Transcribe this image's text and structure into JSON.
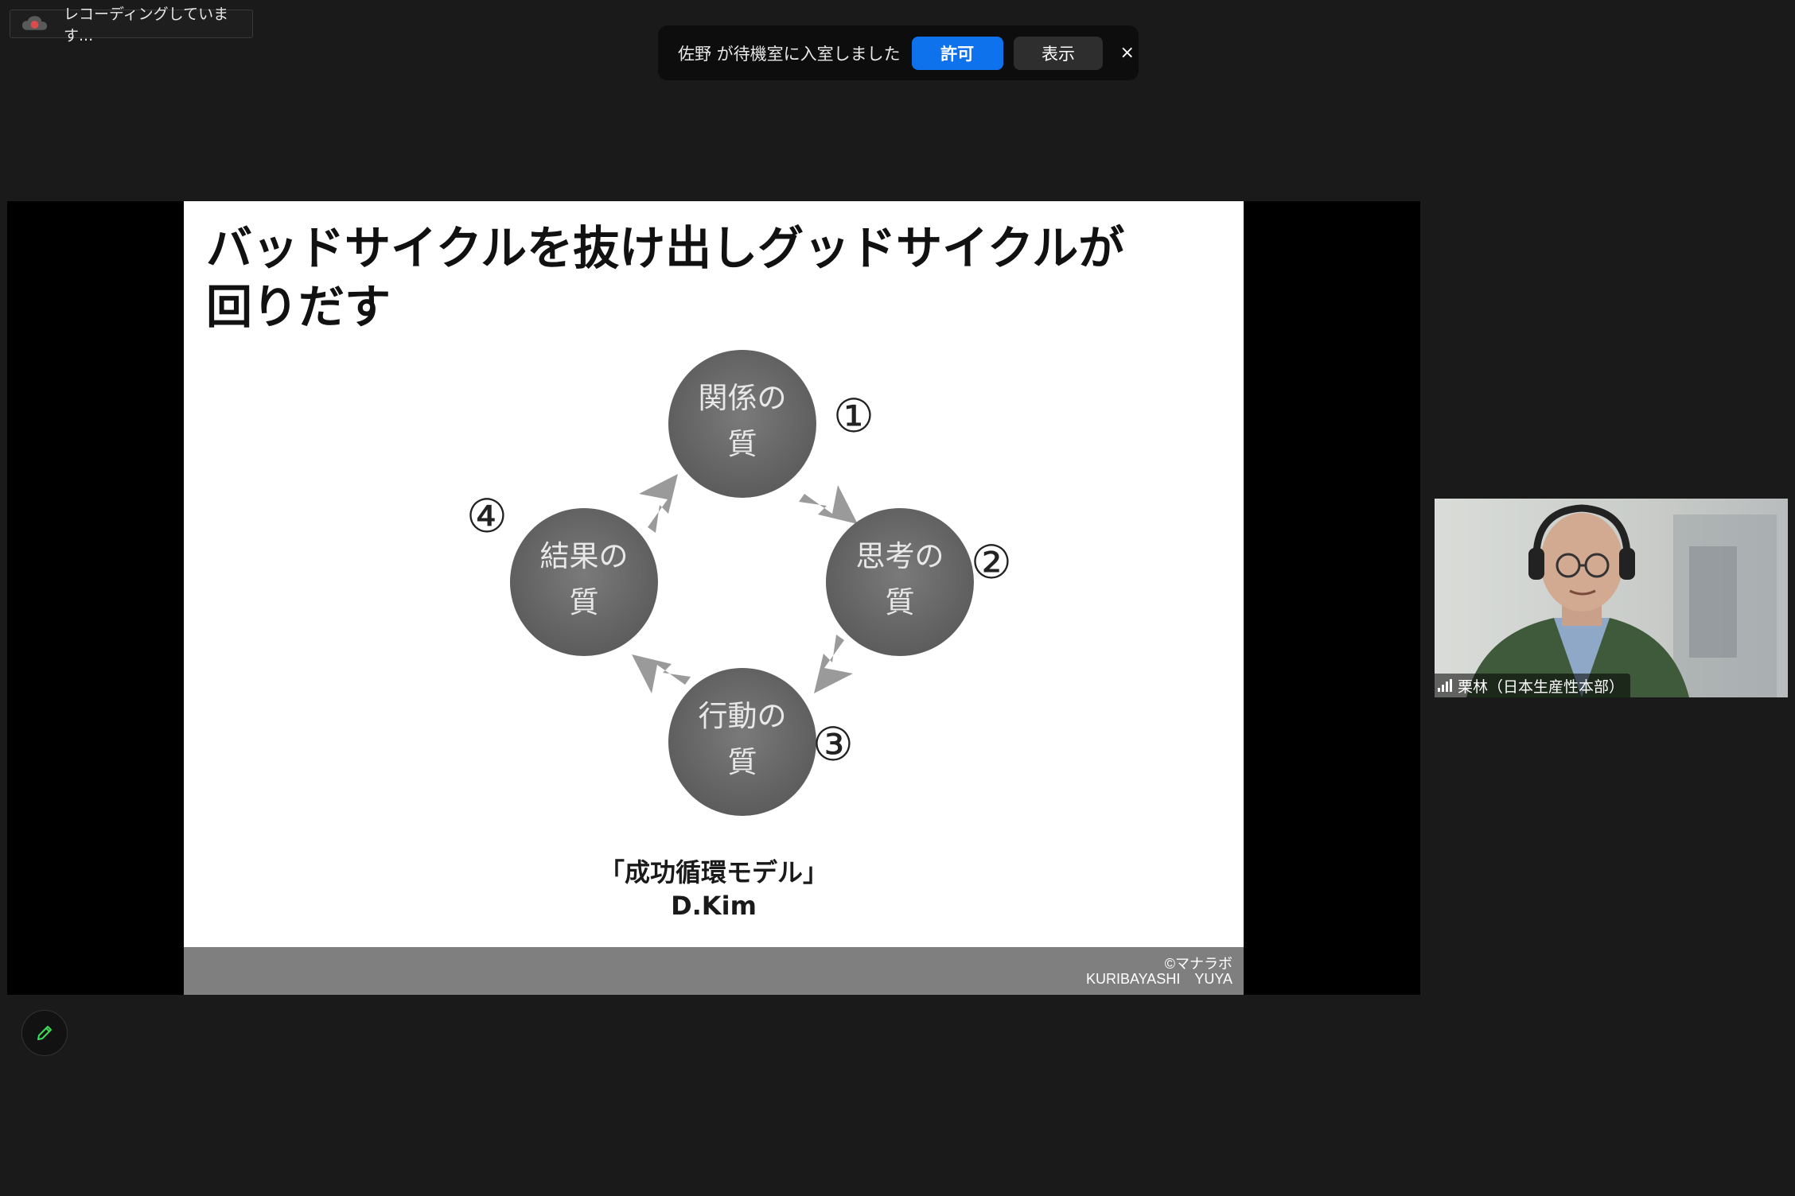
{
  "recording": {
    "label": "レコーディングしています...",
    "icon": "cloud-record-icon"
  },
  "waiting_room": {
    "message": "佐野 が待機室に入室しました",
    "allow_label": "許可",
    "view_label": "表示",
    "close_glyph": "×"
  },
  "slide": {
    "title_line1": "バッドサイクルを抜け出しグッドサイクルが",
    "title_line2": "回りだす",
    "nodes": [
      {
        "num": "①",
        "line1": "関係の",
        "line2": "質"
      },
      {
        "num": "②",
        "line1": "思考の",
        "line2": "質"
      },
      {
        "num": "③",
        "line1": "行動の",
        "line2": "質"
      },
      {
        "num": "④",
        "line1": "結果の",
        "line2": "質"
      }
    ],
    "caption_line1": "「成功循環モデル」",
    "caption_line2": "D.Kim",
    "footer_line1": "©マナラボ",
    "footer_line2": "KURIBAYASHI　YUYA"
  },
  "participant": {
    "name": "栗林（日本生産性本部）",
    "signal_icon": "signal-bars-icon"
  },
  "annotate": {
    "icon": "pencil-icon"
  },
  "colors": {
    "background": "#1a1a1a",
    "accent_blue": "#0e72ed",
    "circle_gray": "#6f6f6f",
    "annotate_green": "#3ddc5a"
  }
}
